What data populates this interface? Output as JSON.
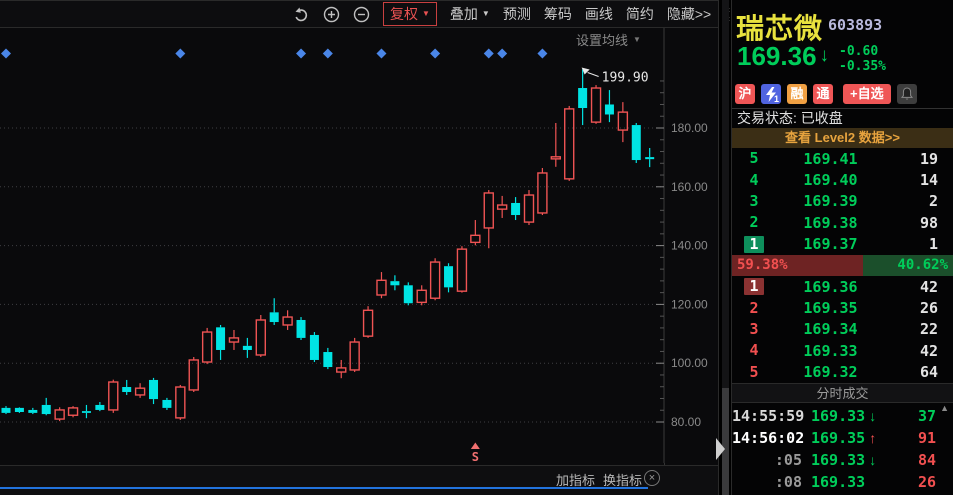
{
  "icons": {
    "caret": "▼",
    "close": "×",
    "scroll_up": "▲",
    "down_arrow": "↓"
  },
  "toolbar": {
    "fuquan": "复权",
    "overlay": "叠加",
    "predict": "预测",
    "chips": "筹码",
    "draw": "画线",
    "simple": "简约",
    "hide": "隐藏>>"
  },
  "chart_ui": {
    "ma_settings": "设置均线",
    "add_indicator": "加指标",
    "switch_indicator": "换指标",
    "s_marker": "S"
  },
  "chart_data": {
    "type": "candlestick",
    "title": "瑞芯微 603893 日K",
    "up_color": "#f05454",
    "down_color": "#00e4e4",
    "grid": true,
    "y_ticks": [
      80,
      100,
      120,
      140,
      160,
      180
    ],
    "y_tick_format": "0.00",
    "annotation": {
      "label": "199.90",
      "candle_index": 43
    },
    "diamond_marker_indices": [
      0,
      13,
      22,
      24,
      28,
      32,
      36,
      37,
      40
    ],
    "s_marker_index": 35,
    "candles": [
      [
        84.8,
        85.4,
        82.7,
        83.1
      ],
      [
        84.8,
        85.0,
        83.1,
        83.4
      ],
      [
        84.1,
        84.8,
        82.7,
        83.1
      ],
      [
        85.8,
        88.2,
        82.3,
        82.7
      ],
      [
        81.0,
        85.0,
        80.3,
        84.1
      ],
      [
        82.3,
        85.4,
        81.6,
        84.8
      ],
      [
        83.7,
        85.8,
        81.3,
        83.1
      ],
      [
        85.8,
        86.8,
        83.7,
        84.1
      ],
      [
        84.1,
        94.4,
        83.1,
        93.6
      ],
      [
        91.9,
        94.3,
        89.2,
        90.2
      ],
      [
        89.2,
        93.2,
        88.2,
        91.5
      ],
      [
        94.3,
        95.0,
        86.1,
        87.8
      ],
      [
        87.5,
        88.2,
        84.1,
        84.8
      ],
      [
        81.4,
        92.6,
        80.7,
        91.9
      ],
      [
        90.9,
        102.1,
        90.2,
        101.1
      ],
      [
        100.4,
        112.0,
        99.7,
        110.6
      ],
      [
        112.2,
        113.0,
        101.1,
        104.5
      ],
      [
        107.2,
        111.3,
        104.5,
        108.6
      ],
      [
        105.9,
        108.6,
        101.8,
        104.5
      ],
      [
        102.8,
        116.4,
        102.1,
        114.7
      ],
      [
        117.3,
        122.1,
        113.0,
        114.0
      ],
      [
        113.0,
        118.0,
        111.3,
        115.7
      ],
      [
        114.7,
        115.7,
        107.9,
        108.6
      ],
      [
        109.6,
        110.6,
        100.4,
        101.1
      ],
      [
        103.8,
        105.2,
        98.0,
        98.7
      ],
      [
        97.0,
        101.1,
        94.9,
        98.4
      ],
      [
        97.7,
        108.6,
        97.0,
        107.2
      ],
      [
        109.2,
        119.4,
        108.6,
        118.0
      ],
      [
        123.2,
        131.0,
        122.1,
        128.2
      ],
      [
        127.9,
        129.9,
        124.8,
        126.5
      ],
      [
        126.5,
        127.5,
        119.7,
        120.4
      ],
      [
        120.7,
        126.5,
        119.7,
        124.8
      ],
      [
        122.1,
        135.7,
        121.4,
        134.4
      ],
      [
        133.0,
        134.0,
        124.1,
        125.8
      ],
      [
        124.5,
        139.8,
        124.0,
        138.8
      ],
      [
        141.1,
        148.7,
        140.1,
        143.5
      ],
      [
        146.0,
        158.9,
        139.1,
        157.9
      ],
      [
        152.4,
        156.9,
        149.4,
        153.8
      ],
      [
        154.5,
        156.5,
        148.7,
        150.4
      ],
      [
        148.0,
        158.9,
        147.0,
        157.2
      ],
      [
        151.1,
        166.4,
        150.4,
        164.7
      ],
      [
        169.5,
        181.7,
        166.8,
        170.2
      ],
      [
        162.7,
        187.5,
        162.0,
        186.5
      ],
      [
        193.6,
        199.9,
        181.0,
        186.8
      ],
      [
        182.0,
        194.6,
        181.4,
        193.6
      ],
      [
        188.0,
        192.9,
        182.0,
        184.6
      ],
      [
        179.3,
        188.8,
        175.2,
        185.4
      ],
      [
        181.0,
        181.7,
        168.1,
        169.1
      ],
      [
        170.1,
        173.2,
        166.7,
        169.4
      ]
    ]
  },
  "panel": {
    "name": "瑞芯微",
    "code": "603893",
    "price": "169.36",
    "change": "-0.60",
    "change_pct": "-0.35%",
    "status": "交易状态: 已收盘",
    "level2_link": "查看 Level2 数据>>",
    "badges": [
      {
        "label": "沪",
        "type": "text",
        "bg": "#ef5656"
      },
      {
        "label": "1",
        "type": "bolt",
        "bg": "#5064e0"
      },
      {
        "label": "融",
        "type": "text",
        "bg": "#f0a043"
      },
      {
        "label": "通",
        "type": "text",
        "bg": "#ef5656"
      },
      {
        "label": "+自选",
        "type": "text",
        "bg": "#ef5656",
        "wide": true
      },
      {
        "label": "",
        "type": "bell",
        "bg": "#3d3d3d"
      }
    ],
    "sell_levels": [
      {
        "n": "5",
        "price": "169.41",
        "vol": "19"
      },
      {
        "n": "4",
        "price": "169.40",
        "vol": "14"
      },
      {
        "n": "3",
        "price": "169.39",
        "vol": "2"
      },
      {
        "n": "2",
        "price": "169.38",
        "vol": "98"
      },
      {
        "n": "1",
        "price": "169.37",
        "vol": "1"
      }
    ],
    "ratio": {
      "left": "59.38%",
      "right": "40.62%"
    },
    "buy_levels": [
      {
        "n": "1",
        "price": "169.36",
        "vol": "42"
      },
      {
        "n": "2",
        "price": "169.35",
        "vol": "26"
      },
      {
        "n": "3",
        "price": "169.34",
        "vol": "22"
      },
      {
        "n": "4",
        "price": "169.33",
        "vol": "42"
      },
      {
        "n": "5",
        "price": "169.32",
        "vol": "64"
      }
    ],
    "ticks_title": "分时成交",
    "ticks": [
      {
        "time": "14:55:59",
        "time_color": "#d8d8d8",
        "price": "169.33",
        "arrow": "↓",
        "arrow_color": "#00cd5a",
        "vol": "37",
        "vol_color": "#00cd5a"
      },
      {
        "time": "14:56:02",
        "time_color": "#ffffff",
        "price": "169.35",
        "arrow": "↑",
        "arrow_color": "#f25050",
        "vol": "91",
        "vol_color": "#f25050"
      },
      {
        "time": ":05",
        "time_color": "#9a9a9a",
        "price": "169.33",
        "arrow": "↓",
        "arrow_color": "#00cd5a",
        "vol": "84",
        "vol_color": "#f25050"
      },
      {
        "time": ":08",
        "time_color": "#9a9a9a",
        "price": "169.33",
        "arrow": "",
        "arrow_color": "",
        "vol": "26",
        "vol_color": "#f25050"
      }
    ]
  }
}
